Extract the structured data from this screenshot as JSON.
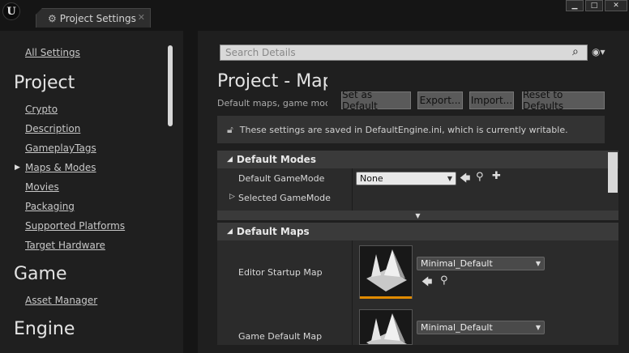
{
  "window": {
    "logo_letter": "U",
    "tab_label": "Project Settings",
    "tab_close": "✕",
    "minimize": "▁",
    "maximize": "□",
    "close": "✕"
  },
  "sidebar": {
    "all_settings": "All Settings",
    "project_heading": "Project",
    "project_items": [
      "Crypto",
      "Description",
      "GameplayTags",
      "Maps & Modes",
      "Movies",
      "Packaging",
      "Supported Platforms",
      "Target Hardware"
    ],
    "selected_item": "Maps & Modes",
    "game_heading": "Game",
    "game_items": [
      "Asset Manager"
    ],
    "engine_heading": "Engine"
  },
  "details": {
    "search_placeholder": "Search Details",
    "title": "Project - Maps & Modes",
    "subtitle": "Default maps, game modes and other map related settings.",
    "buttons": {
      "set_default": "Set as Default",
      "export": "Export...",
      "import": "Import...",
      "reset": "Reset to Defaults"
    },
    "notice": "These settings are saved in DefaultEngine.ini, which is currently writable."
  },
  "default_modes": {
    "header": "Default Modes",
    "default_gamemode_label": "Default GameMode",
    "default_gamemode_value": "None",
    "selected_gamemode_label": "Selected GameMode"
  },
  "default_maps": {
    "header": "Default Maps",
    "editor_startup_label": "Editor Startup Map",
    "editor_startup_value": "Minimal_Default",
    "game_default_label": "Game Default Map",
    "game_default_value": "Minimal_Default"
  },
  "colors": {
    "thumbnail_selected": "#e08a00"
  }
}
